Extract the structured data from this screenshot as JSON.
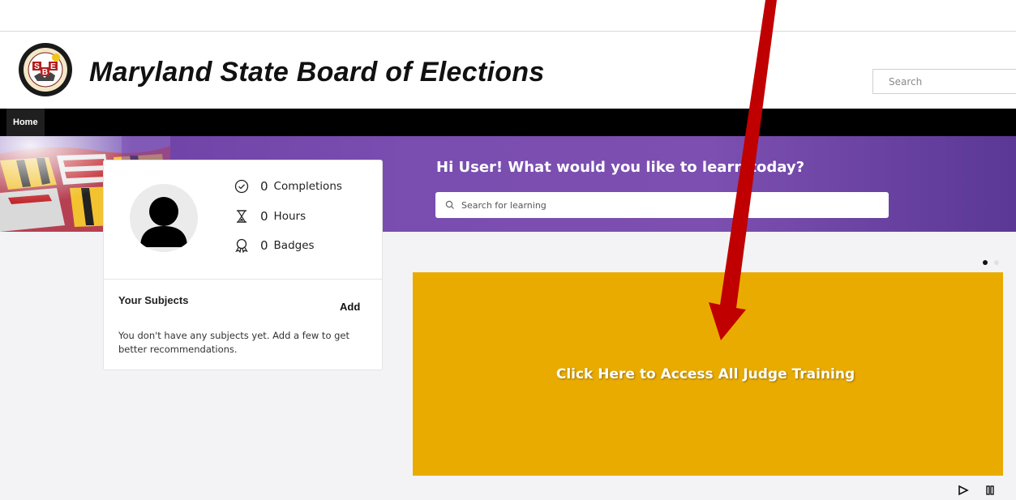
{
  "header": {
    "title": "Maryland State Board of Elections",
    "logo_icon": "sbe-seal-logo",
    "search_placeholder": "Search"
  },
  "nav": {
    "items": [
      {
        "label": "Home",
        "active": true
      }
    ]
  },
  "banner": {
    "greeting": "Hi User! What would you like to learn today?",
    "search_placeholder": "Search for learning"
  },
  "profile": {
    "stats": [
      {
        "icon": "check-circle-icon",
        "value": "0",
        "label": "Completions"
      },
      {
        "icon": "hourglass-icon",
        "value": "0",
        "label": "Hours"
      },
      {
        "icon": "badge-icon",
        "value": "0",
        "label": "Badges"
      }
    ],
    "subjects_title": "Your Subjects",
    "subjects_add": "Add",
    "subjects_empty": "You don't have any subjects yet. Add a few to get better recommendations."
  },
  "carousel": {
    "slide_text": "Click Here to Access All Judge Training",
    "slide_color": "#eaab00",
    "active_dot": 1,
    "dot_count": 2
  },
  "colors": {
    "banner": "#7a4db0",
    "navbar": "#000000",
    "annotation_arrow": "#c00000"
  }
}
